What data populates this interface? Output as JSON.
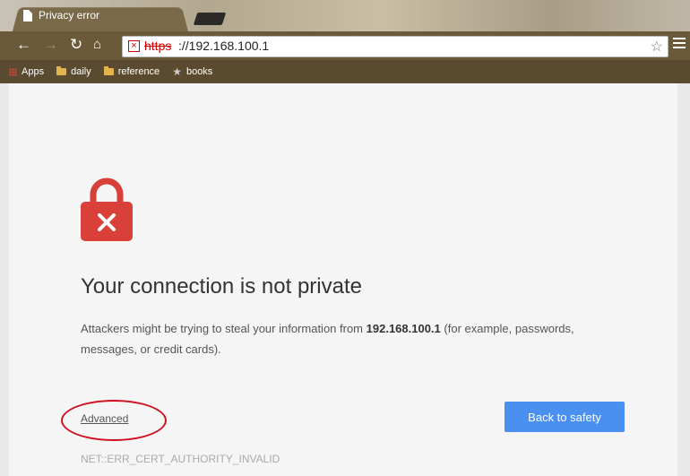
{
  "browser": {
    "tab_title": "Privacy error",
    "url_scheme": "https",
    "url_rest": "://192.168.100.1",
    "bookmarks": [
      "Apps",
      "daily",
      "reference",
      "books"
    ]
  },
  "page": {
    "heading": "Your connection is not private",
    "body_prefix": "Attackers might be trying to steal your information from ",
    "host": "192.168.100.1",
    "body_suffix": " (for example, passwords, messages, or credit cards).",
    "advanced_label": "Advanced",
    "back_button_label": "Back to safety",
    "error_code": "NET::ERR_CERT_AUTHORITY_INVALID"
  },
  "colors": {
    "danger_red": "#d9403a",
    "primary_blue": "#4a90f0",
    "annotation_circle": "#d01020"
  }
}
